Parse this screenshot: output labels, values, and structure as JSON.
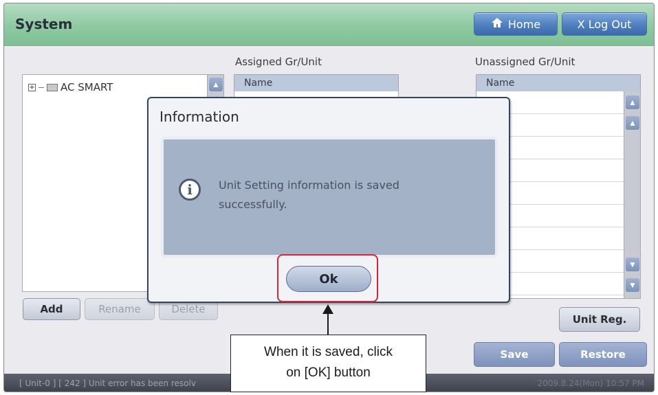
{
  "app": {
    "title": "System"
  },
  "header": {
    "home_label": "Home",
    "logout_label": "X Log Out"
  },
  "tree": {
    "root_label": "AC SMART"
  },
  "assigned": {
    "label": "Assigned Gr/Unit",
    "col_name": "Name"
  },
  "unassigned": {
    "label": "Unassigned Gr/Unit",
    "col_name": "Name"
  },
  "buttons": {
    "add": "Add",
    "rename": "Rename",
    "delete": "Delete",
    "unit_reg": "Unit Reg.",
    "save": "Save",
    "restore": "Restore"
  },
  "status": {
    "message": "[ Unit-0 ] [ 242 ] Unit error has been resolv",
    "datetime": "2009.8.24(Mon)  10:57 PM"
  },
  "dialog": {
    "title": "Information",
    "message": "Unit Setting information is saved successfully.",
    "ok_label": "Ok"
  },
  "annotation": {
    "line1": "When it is saved, click",
    "line2": "on [OK] button"
  },
  "colors": {
    "titlebar": "#8ec9a2",
    "dialog_body": "#a3b2c7",
    "highlight": "#d8253a",
    "button_blue": "#4f7fbf"
  }
}
